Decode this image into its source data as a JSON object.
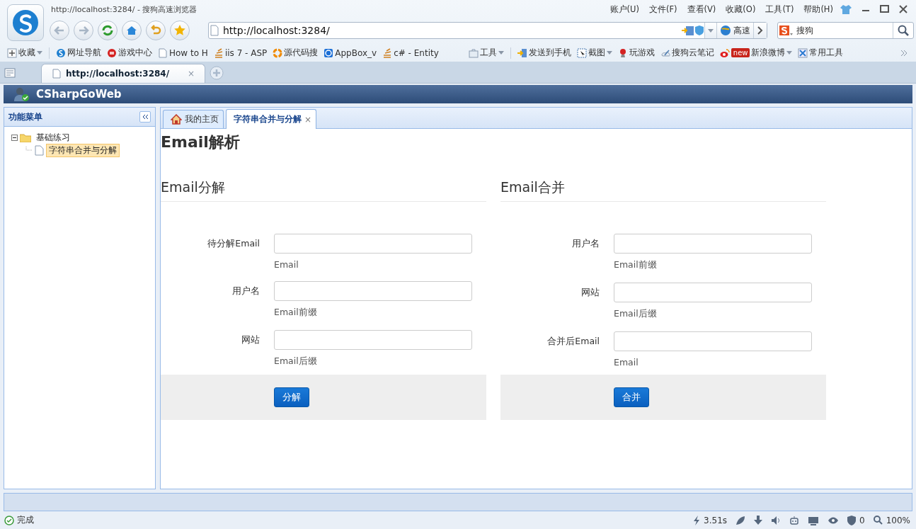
{
  "browser": {
    "title": "http://localhost:3284/ - 搜狗高速浏览器",
    "menu": [
      "账户(U)",
      "文件(F)",
      "查看(V)",
      "收藏(O)",
      "工具(T)",
      "帮助(H)"
    ],
    "address": "http://localhost:3284/",
    "speed_button": "高速",
    "search": {
      "value": "搜狗"
    },
    "bookmarks": [
      {
        "label": "收藏",
        "dropdown": true
      },
      {
        "label": "网址导航",
        "dropdown": false
      },
      {
        "label": "游戏中心",
        "dropdown": false
      },
      {
        "label": "How to H",
        "dropdown": false
      },
      {
        "label": "iis 7 - ASP",
        "dropdown": false
      },
      {
        "label": "源代码搜",
        "dropdown": false
      },
      {
        "label": "AppBox_v",
        "dropdown": false
      },
      {
        "label": "c# - Entity",
        "dropdown": false
      }
    ],
    "tools": [
      {
        "label": "工具",
        "dropdown": true
      },
      {
        "label": "发送到手机",
        "dropdown": false
      },
      {
        "label": "截图",
        "dropdown": true
      },
      {
        "label": "玩游戏",
        "dropdown": false
      },
      {
        "label": "搜狗云笔记",
        "dropdown": false
      },
      {
        "label": "新浪微博",
        "dropdown": true,
        "badge": "new"
      },
      {
        "label": "常用工具",
        "dropdown": false
      }
    ],
    "tabs": [
      {
        "label": "http://localhost:3284/",
        "selected": true,
        "close": "×"
      }
    ]
  },
  "app": {
    "title": "CSharpGoWeb",
    "sidebar": {
      "title": "功能菜单",
      "tree": [
        {
          "label": "基础练习",
          "expanded": true,
          "selected": false,
          "children": [
            {
              "label": "字符串合并与分解",
              "selected": true
            }
          ]
        }
      ]
    },
    "tabs": [
      {
        "label": "我的主页",
        "selected": false
      },
      {
        "label": "字符串合并与分解",
        "selected": true,
        "close": "×"
      }
    ],
    "page_title": "Email解析",
    "forms": [
      {
        "title": "Email分解",
        "fields": [
          {
            "label": "待分解Email",
            "hint": "Email"
          },
          {
            "label": "用户名",
            "hint": "Email前缀"
          },
          {
            "label": "网站",
            "hint": "Email后缀"
          }
        ],
        "button": "分解"
      },
      {
        "title": "Email合并",
        "fields": [
          {
            "label": "用户名",
            "hint": "Email前缀"
          },
          {
            "label": "网站",
            "hint": "Email后缀"
          },
          {
            "label": "合并后Email",
            "hint": "Email"
          }
        ],
        "button": "合并"
      }
    ]
  },
  "status_bar": {
    "status": "完成",
    "load_time": "3.51s",
    "blocked_count": "0",
    "zoom": "100%"
  }
}
